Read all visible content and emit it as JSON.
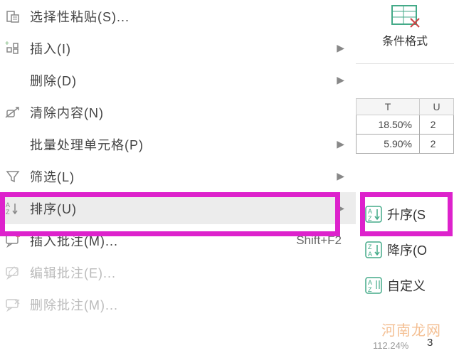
{
  "menu": {
    "paste_special": "选择性粘贴(S)...",
    "insert": "插入(I)",
    "delete": "删除(D)",
    "clear_contents": "清除内容(N)",
    "batch_cells": "批量处理单元格(P)",
    "filter": "筛选(L)",
    "sort": "排序(U)",
    "insert_comment": "插入批注(M)...",
    "insert_comment_shortcut": "Shift+F2",
    "edit_comment": "编辑批注(E)...",
    "delete_comment": "删除批注(M)...",
    "arrow": "▶"
  },
  "ribbon": {
    "cond_format": "条件格式"
  },
  "sheet": {
    "col_t": "T",
    "col_u": "U",
    "rows": [
      {
        "t": "18.50%",
        "u": "2"
      },
      {
        "t": "5.90%",
        "u": "2"
      }
    ]
  },
  "submenu": {
    "asc": "升序(S",
    "desc": "降序(O",
    "custom": "自定义"
  },
  "bottom": {
    "val": "112.24%",
    "cell": "3"
  },
  "watermark": "河南龙网"
}
